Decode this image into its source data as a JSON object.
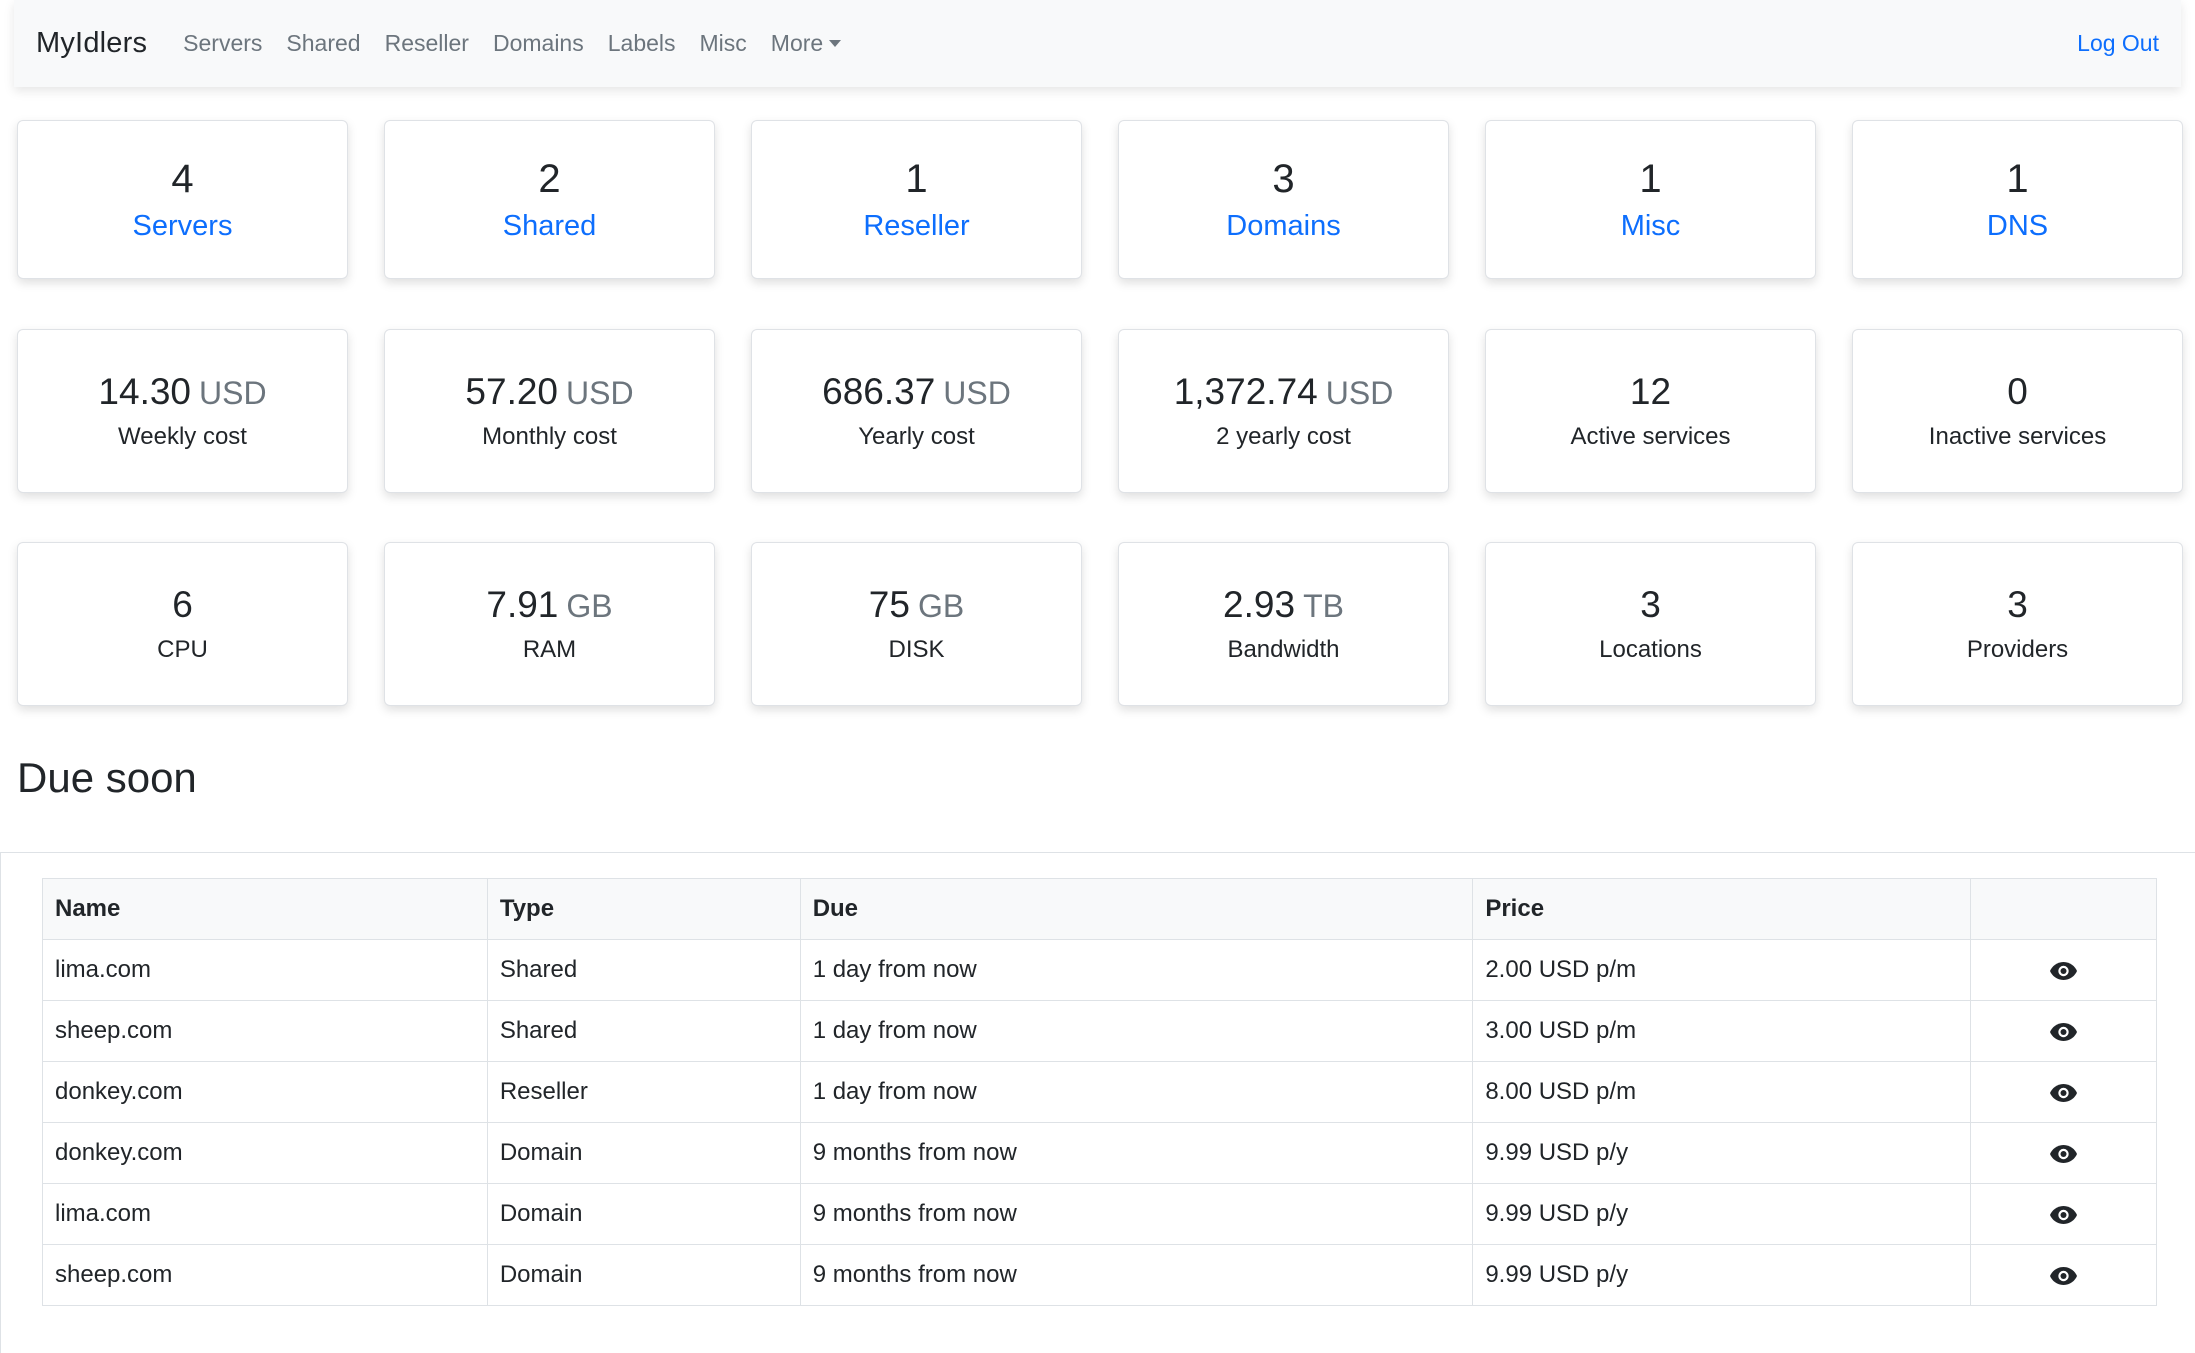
{
  "navbar": {
    "brand": "MyIdlers",
    "items": [
      "Servers",
      "Shared",
      "Reseller",
      "Domains",
      "Labels",
      "Misc"
    ],
    "more_label": "More",
    "logout_label": "Log Out"
  },
  "counts": [
    {
      "value": "4",
      "label": "Servers"
    },
    {
      "value": "2",
      "label": "Shared"
    },
    {
      "value": "1",
      "label": "Reseller"
    },
    {
      "value": "3",
      "label": "Domains"
    },
    {
      "value": "1",
      "label": "Misc"
    },
    {
      "value": "1",
      "label": "DNS"
    }
  ],
  "costs": [
    {
      "value": "14.30",
      "unit": "USD",
      "label": "Weekly cost"
    },
    {
      "value": "57.20",
      "unit": "USD",
      "label": "Monthly cost"
    },
    {
      "value": "686.37",
      "unit": "USD",
      "label": "Yearly cost"
    },
    {
      "value": "1,372.74",
      "unit": "USD",
      "label": "2 yearly cost"
    },
    {
      "value": "12",
      "unit": "",
      "label": "Active services"
    },
    {
      "value": "0",
      "unit": "",
      "label": "Inactive services"
    }
  ],
  "resources": [
    {
      "value": "6",
      "unit": "",
      "label": "CPU"
    },
    {
      "value": "7.91",
      "unit": "GB",
      "label": "RAM"
    },
    {
      "value": "75",
      "unit": "GB",
      "label": "DISK"
    },
    {
      "value": "2.93",
      "unit": "TB",
      "label": "Bandwidth"
    },
    {
      "value": "3",
      "unit": "",
      "label": "Locations"
    },
    {
      "value": "3",
      "unit": "",
      "label": "Providers"
    }
  ],
  "due_soon": {
    "title": "Due soon",
    "columns": [
      "Name",
      "Type",
      "Due",
      "Price",
      ""
    ],
    "rows": [
      {
        "name": "lima.com",
        "type": "Shared",
        "due": "1 day from now",
        "price": "2.00 USD p/m"
      },
      {
        "name": "sheep.com",
        "type": "Shared",
        "due": "1 day from now",
        "price": "3.00 USD p/m"
      },
      {
        "name": "donkey.com",
        "type": "Reseller",
        "due": "1 day from now",
        "price": "8.00 USD p/m"
      },
      {
        "name": "donkey.com",
        "type": "Domain",
        "due": "9 months from now",
        "price": "9.99 USD p/y"
      },
      {
        "name": "lima.com",
        "type": "Domain",
        "due": "9 months from now",
        "price": "9.99 USD p/y"
      },
      {
        "name": "sheep.com",
        "type": "Domain",
        "due": "9 months from now",
        "price": "9.99 USD p/y"
      }
    ],
    "row_icon": "eye-icon"
  },
  "colors": {
    "link": "#0d6efd",
    "muted": "#6c757d",
    "navbar_bg": "#f8f9fa"
  }
}
